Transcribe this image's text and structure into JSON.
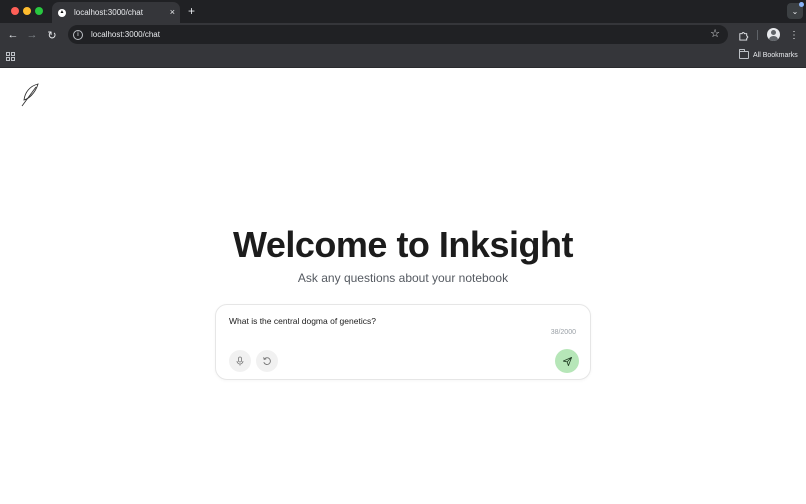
{
  "browser": {
    "tab": {
      "title": "localhost:3000/chat",
      "close_icon": "×",
      "favicon": "triangle-favicon"
    },
    "new_tab_icon": "+",
    "tab_search_icon": "chevron-down",
    "toolbar": {
      "back_icon": "←",
      "forward_icon": "→",
      "reload_icon": "↻",
      "info_icon": "i",
      "url": "localhost:3000/chat",
      "star_icon": "☆",
      "extensions_icon": "puzzle",
      "menu_icon": "⋮"
    },
    "bookmarks_bar": {
      "all_bookmarks_label": "All Bookmarks"
    }
  },
  "page": {
    "logo": "feather-icon",
    "title": "Welcome to Inksight",
    "subtitle": "Ask any questions about your notebook",
    "chat": {
      "input_value": "What is the central dogma of genetics?",
      "char_count": "38/2000",
      "mic_icon": "microphone",
      "reset_icon": "rotate-ccw",
      "send_icon": "send",
      "send_color": "#b6e6b8"
    }
  },
  "colors": {
    "titlebar": "#202124",
    "toolbar": "#35363a",
    "title_text": "#1c1c1c",
    "subtitle_text": "#555a61"
  }
}
